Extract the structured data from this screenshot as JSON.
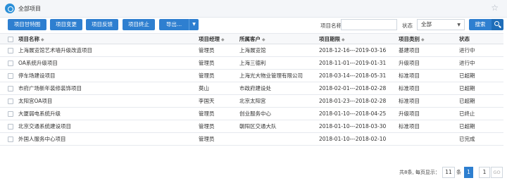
{
  "header": {
    "title": "全部项目",
    "star": "☆"
  },
  "toolbar": {
    "buttons": [
      "项目甘特图",
      "项目变更",
      "项目反馈",
      "项目终止",
      "导出..."
    ],
    "filter_name_label": "项目名称",
    "filter_name_value": "",
    "filter_status_label": "状态",
    "filter_status_value": "全部",
    "search_label": "搜索"
  },
  "table": {
    "columns": [
      "项目名称",
      "项目经理",
      "所属客户",
      "项目期限",
      "项目类别",
      "状态"
    ],
    "rows": [
      [
        "上海展览馆艺术墙升级改造项目",
        "管理员",
        "上海展览馆",
        "2018-12-16---2019-03-16",
        "基建项目",
        "进行中"
      ],
      [
        "OA系统升级项目",
        "管理员",
        "上海三德利",
        "2018-11-01---2019-01-31",
        "升级项目",
        "进行中"
      ],
      [
        "停车场建设项目",
        "管理员",
        "上海光大物业管理有限公司",
        "2018-03-14---2018-05-31",
        "标准项目",
        "已超期"
      ],
      [
        "市府广场新年装修装饰项目",
        "莫山",
        "市政府建设处",
        "2018-02-01---2018-02-28",
        "标准项目",
        "已超期"
      ],
      [
        "太阳宫OA项目",
        "李国天",
        "北京太阳宫",
        "2018-01-23---2018-02-28",
        "标准项目",
        "已超期"
      ],
      [
        "大厦弱电系统升级",
        "管理员",
        "创业服务中心",
        "2018-01-10---2018-04-25",
        "升级项目",
        "已终止"
      ],
      [
        "北京交通系统建设项目",
        "管理员",
        "朝阳区交通大队",
        "2018-01-10---2018-03-30",
        "标准项目",
        "已超期"
      ],
      [
        "外国人服务中心项目",
        "管理员",
        "",
        "2018-01-10---2018-02-10",
        "",
        "已完成"
      ]
    ]
  },
  "pager": {
    "summary": "共8条, 每页显示：",
    "page_size": "11",
    "unit": "条",
    "current_page": "1",
    "goto_value": "1",
    "go_label": "GO"
  },
  "colors": {
    "accent": "#2e7fd0",
    "header_bg": "#f4f6f9"
  }
}
